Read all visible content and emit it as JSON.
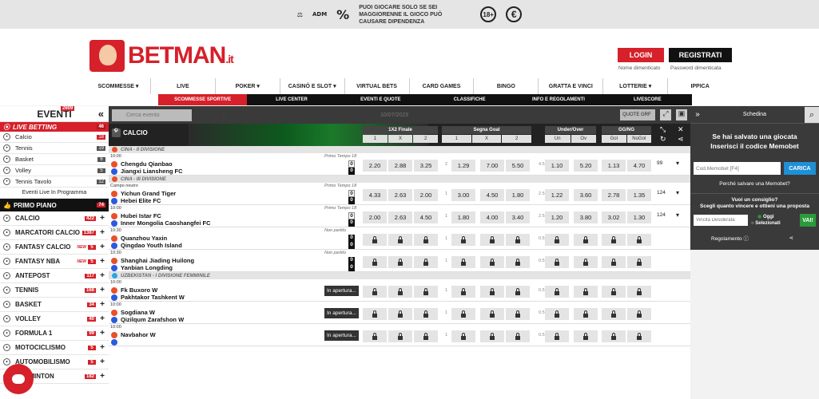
{
  "topbar": {
    "adm": "ADM",
    "text": "PUOI GIOCARE SOLO SE SEI MAGGIORENNE IL GIOCO PUÒ CAUSARE DIPENDENZA",
    "age": "18+",
    "percent": "%",
    "euro": "€"
  },
  "header": {
    "logo_text": "BETMAN",
    "logo_tld": ".it",
    "login": "LOGIN",
    "register": "REGISTRATI",
    "forgot_name": "Nome dimenticato",
    "forgot_pw": "Password dimenticata"
  },
  "nav": [
    "SCOMMESSE ▾",
    "LIVE",
    "POKER ▾",
    "CASINÒ E SLOT ▾",
    "VIRTUAL BETS",
    "CARD GAMES",
    "BINGO",
    "GRATTA E VINCI",
    "LOTTERIE ▾",
    "IPPICA"
  ],
  "subnav": [
    "SCOMMESSE SPORTIVE",
    "LIVE CENTER",
    "EVENTI E QUOTE",
    "CLASSIFICHE",
    "INFO E REGOLAMENTI",
    "LIVESCORE"
  ],
  "sidebar": {
    "title": "EVENTI",
    "count": "2609",
    "live_label": "LIVE BETTING",
    "live_count": "46",
    "live_items": [
      {
        "label": "Calcio",
        "count": "18",
        "red": true
      },
      {
        "label": "Tennis",
        "count": "19"
      },
      {
        "label": "Basket",
        "count": "6"
      },
      {
        "label": "Volley",
        "count": "5"
      },
      {
        "label": "Tennis Tavolo",
        "count": "12"
      }
    ],
    "programmed": "Eventi Live In Programma",
    "primo_label": "PRIMO PIANO",
    "primo_count": "74",
    "sports": [
      {
        "label": "CALCIO",
        "count": "422"
      },
      {
        "label": "MARCATORI CALCIO",
        "count": "1387"
      },
      {
        "label": "FANTASY CALCIO",
        "count": "5",
        "new": "NEW"
      },
      {
        "label": "FANTASY NBA",
        "count": "5",
        "new": "NEW"
      },
      {
        "label": "ANTEPOST",
        "count": "117"
      },
      {
        "label": "TENNIS",
        "count": "168"
      },
      {
        "label": "BASKET",
        "count": "34"
      },
      {
        "label": "VOLLEY",
        "count": "40"
      },
      {
        "label": "FORMULA 1",
        "count": "99"
      },
      {
        "label": "MOTOCICLISMO",
        "count": "5"
      },
      {
        "label": "AUTOMOBILISMO",
        "count": "5"
      },
      {
        "label": "BADMINTON",
        "count": "182"
      }
    ]
  },
  "center": {
    "search_placeholder": "Cerca evento",
    "date": "10/07/2023",
    "quote_label": "QUOTE GRF",
    "section": "CALCIO",
    "markets": [
      {
        "title": "1X2 Finale",
        "cols": [
          "1",
          "X",
          "2"
        ]
      },
      {
        "title": "Segna Goal",
        "cols": [
          "1",
          "X",
          "2"
        ]
      },
      {
        "title": "Under/Over",
        "cols": [
          "Un",
          "Ov"
        ]
      },
      {
        "title": "GG/NG",
        "cols": [
          "Gol",
          "NoGol"
        ]
      }
    ],
    "groups": [
      {
        "name": "CINA - II DIVISIONE",
        "flag": "cn",
        "matches": [
          {
            "time": "10:00",
            "state": "Primo Tempo  18",
            "t1": "Chengdu Qianbao",
            "t2": "Jiangxi Liansheng FC",
            "s1": "0",
            "s2": "0",
            "live": true,
            "odds": [
              "2.20",
              "2.88",
              "3.25",
              "1.29",
              "7.00",
              "5.50",
              "1.10",
              "5.20",
              "1.13",
              "4.70"
            ],
            "h1": "2",
            "h2": "4.5",
            "more": "99"
          }
        ]
      },
      {
        "name": "CINA - III DIVISIONE",
        "flag": "cn",
        "matches": [
          {
            "time": "Campo neutro",
            "state": "Primo Tempo  18",
            "t1": "Yichun Grand Tiger",
            "t2": "Hebei Elite FC",
            "s1": "0",
            "s2": "0",
            "live": true,
            "odds": [
              "4.33",
              "2.63",
              "2.00",
              "3.00",
              "4.50",
              "1.80",
              "1.22",
              "3.60",
              "2.78",
              "1.35"
            ],
            "h1": "1",
            "h2": "2.5",
            "more": "124"
          },
          {
            "time": "10:00",
            "state": "Primo Tempo  18",
            "t1": "Hubei Istar FC",
            "t2": "Inner Mongolia Caoshangfei FC",
            "s1": "0",
            "s2": "0",
            "live": true,
            "odds": [
              "2.00",
              "2.63",
              "4.50",
              "1.80",
              "4.00",
              "3.40",
              "1.20",
              "3.80",
              "3.02",
              "1.30"
            ],
            "h1": "1",
            "h2": "2.5",
            "more": "124"
          },
          {
            "time": "10:30",
            "state": "Non partito",
            "t1": "Quanzhou Yaxin",
            "t2": "Qingdao Youth Island",
            "s1": "0",
            "s2": "0",
            "live": false,
            "h1": "1",
            "h2": "0.5"
          },
          {
            "time": "10:30",
            "state": "Non partito",
            "t1": "Shanghai Jiading Huilong",
            "t2": "Yanbian Longding",
            "s1": "0",
            "s2": "0",
            "live": false,
            "h1": "1",
            "h2": "0.5"
          }
        ]
      },
      {
        "name": "UZBEKISTAN - I DIVISIONE FEMMINILE",
        "flag": "uz",
        "matches": [
          {
            "time": "10:00",
            "state": "",
            "t1": "Fk Buxoro W",
            "t2": "Pakhtakor Tashkent W",
            "opening": "In apertura...",
            "h1": "1",
            "h2": "0.5"
          },
          {
            "time": "10:00",
            "state": "",
            "t1": "Sogdiana W",
            "t2": "Qizilqum Zarafshon W",
            "opening": "In apertura...",
            "h1": "1",
            "h2": "0.5"
          },
          {
            "time": "10:00",
            "state": "",
            "t1": "Navbahor W",
            "t2": "",
            "opening": "In apertura...",
            "h1": "1",
            "h2": "0.5"
          }
        ]
      }
    ]
  },
  "schedina": {
    "title": "Schedina",
    "msg1": "Se hai salvato una giocata",
    "msg2": "Inserisci il codice Memobet",
    "memo_placeholder": "Cod.Memobet [F4]",
    "carica": "CARICA",
    "why": "Perché salvare una Memobet?",
    "cons1": "Vuoi un consiglio?",
    "cons2": "Scegli quanto vincere e ottieni una proposta",
    "vinc_placeholder": "Vincita Desiderata",
    "oggi": "Oggi",
    "selezionati": "Selezionati",
    "vai": "VAI!",
    "regolamento": "Regolamento"
  },
  "colors": {
    "brand": "#d6202a",
    "dark": "#111111",
    "panel": "#3a3a3a",
    "accent_blue": "#1e90d6",
    "accent_green": "#2a9a3a"
  }
}
